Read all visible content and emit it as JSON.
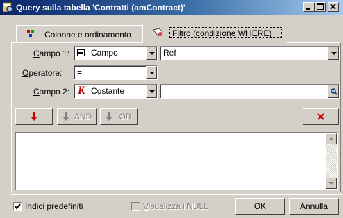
{
  "window": {
    "title": "Query sulla tabella 'Contratti (amContract)'"
  },
  "tabs": [
    {
      "label": "Colonne e ordinamento",
      "active": false
    },
    {
      "label": "Filtro (condizione WHERE)",
      "active": true
    }
  ],
  "fields": {
    "campo1": {
      "label_underlined": "C",
      "label_rest": "ampo 1:",
      "type_value": "Campo",
      "value": "Ref"
    },
    "operatore": {
      "label_underlined": "O",
      "label_rest": "peratore:",
      "value": "="
    },
    "campo2": {
      "label_underlined": "C",
      "label_rest": "ampo 2:",
      "type_value": "Costante",
      "value": ""
    }
  },
  "buttons": {
    "and_label": "AND",
    "or_label": "OR",
    "ok_label": "OK",
    "cancel_label": "Annulla"
  },
  "options": {
    "indici_underlined": "I",
    "indici_rest": "ndici predefiniti",
    "indici_checked": true,
    "null_underlined": "V",
    "null_rest": "isualizza i NULL",
    "null_checked": false,
    "null_enabled": false
  },
  "colors": {
    "titlebar_start": "#0a246a",
    "titlebar_end": "#a6caf0",
    "arrow_red": "#cc0000",
    "face": "#d4d0c8"
  }
}
